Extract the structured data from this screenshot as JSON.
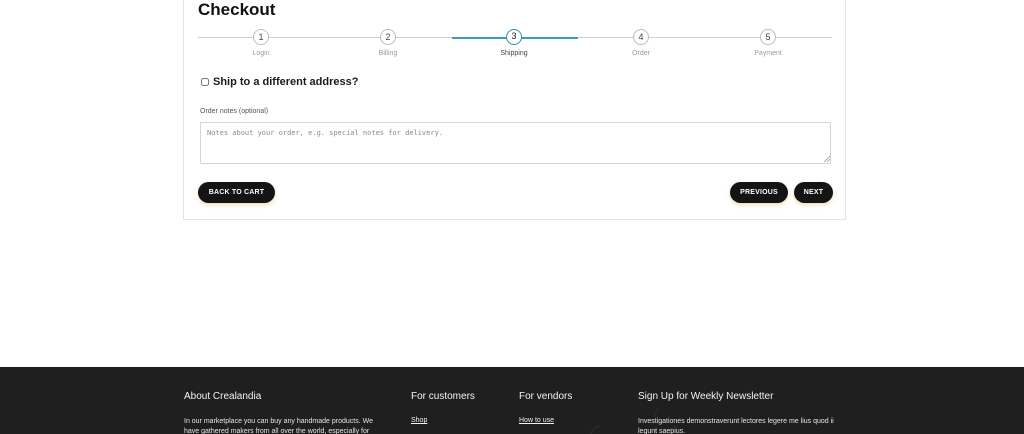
{
  "checkout": {
    "title": "Checkout",
    "steps": [
      {
        "number": "1",
        "label": "Login"
      },
      {
        "number": "2",
        "label": "Billing"
      },
      {
        "number": "3",
        "label": "Shipping"
      },
      {
        "number": "4",
        "label": "Order"
      },
      {
        "number": "5",
        "label": "Payment"
      }
    ],
    "active_step": 3,
    "ship_different_label": "Ship to a different address?",
    "order_notes_label": "Order notes (optional)",
    "order_notes_placeholder": "Notes about your order, e.g. special notes for delivery.",
    "order_notes_value": "",
    "back_to_cart_label": "BACK TO CART",
    "previous_label": "PREVIOUS",
    "next_label": "NEXT",
    "accent_color": "#3a9bc8"
  },
  "footer": {
    "about": {
      "heading": "About Crealandia",
      "text": "In our marketplace you can buy any handmade products. We have gathered makers from all over the world, especially for"
    },
    "customers": {
      "heading": "For customers",
      "link": "Shop"
    },
    "vendors": {
      "heading": "For vendors",
      "link": "How to use"
    },
    "newsletter": {
      "heading": "Sign Up for Weekly Newsletter",
      "text": "Investigationes demonstraverunt lectores legere me lius quod ii legunt saepius."
    }
  }
}
